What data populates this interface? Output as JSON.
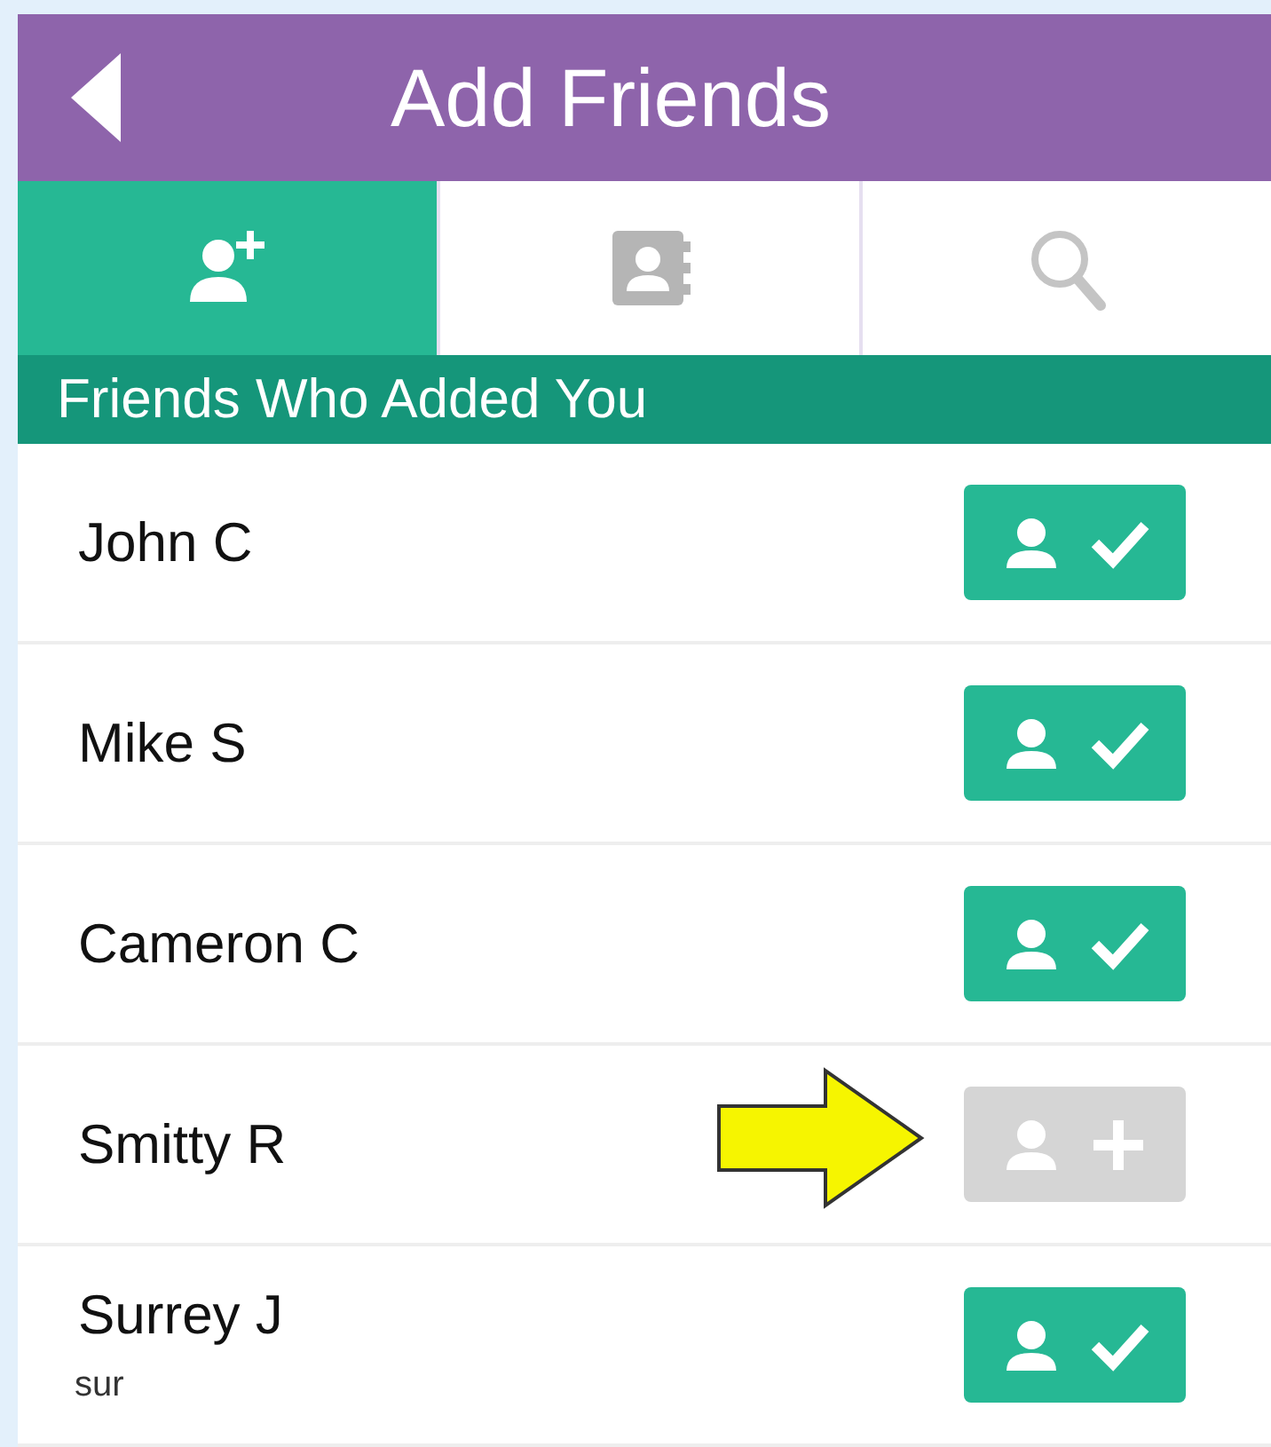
{
  "header": {
    "title": "Add Friends"
  },
  "tabs": [
    {
      "kind": "add-friend",
      "selected": true
    },
    {
      "kind": "contacts",
      "selected": false
    },
    {
      "kind": "search",
      "selected": false
    }
  ],
  "section": {
    "title": "Friends Who Added You"
  },
  "friends": [
    {
      "name": "John C",
      "added": true,
      "highlighted": false
    },
    {
      "name": "Mike S",
      "added": true,
      "highlighted": false
    },
    {
      "name": "Cameron C",
      "added": true,
      "highlighted": false
    },
    {
      "name": "Smitty R",
      "added": false,
      "highlighted": true
    },
    {
      "name": "Surrey J",
      "subtitle": "sur",
      "added": true,
      "highlighted": false
    }
  ]
}
